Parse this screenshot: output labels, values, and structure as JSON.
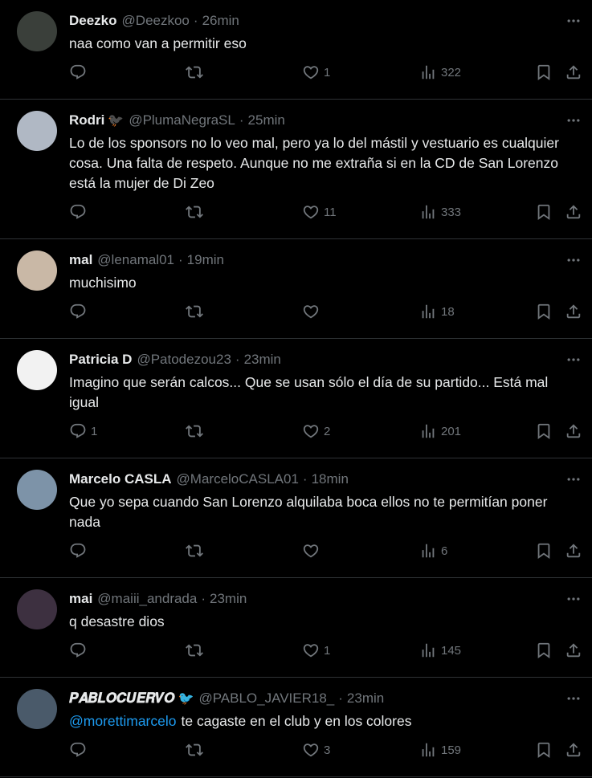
{
  "tweets": [
    {
      "name": "Deezko",
      "extra": "",
      "handle": "@Deezkoo",
      "time": "26min",
      "text": "naa como van a permitir eso",
      "mention": "",
      "replies": "",
      "retweets": "",
      "likes": "1",
      "views": "322",
      "avatar_color": "#3a3f3a"
    },
    {
      "name": "Rodri",
      "extra": "🐦‍⬛",
      "handle": "@PlumaNegraSL",
      "time": "25min",
      "text": "Lo de los sponsors no lo veo mal, pero ya lo del mástil y vestuario es cualquier cosa. Una falta de respeto. Aunque no me extraña si en la CD de San Lorenzo está la mujer de Di Zeo",
      "mention": "",
      "replies": "",
      "retweets": "",
      "likes": "11",
      "views": "333",
      "avatar_color": "#b0b8c4"
    },
    {
      "name": "mal",
      "extra": "",
      "handle": "@lenamal01",
      "time": "19min",
      "text": "muchisimo",
      "mention": "",
      "replies": "",
      "retweets": "",
      "likes": "",
      "views": "18",
      "avatar_color": "#c9b8a6"
    },
    {
      "name": "Patricia D",
      "extra": "",
      "handle": "@Patodezou23",
      "time": "23min",
      "text": "Imagino que serán calcos... Que se usan sólo el día de su partido... Está mal igual",
      "mention": "",
      "replies": "1",
      "retweets": "",
      "likes": "2",
      "views": "201",
      "avatar_color": "#f2f2f2"
    },
    {
      "name": "Marcelo CASLA",
      "extra": "",
      "handle": "@MarceloCASLA01",
      "time": "18min",
      "text": "Que yo sepa cuando San Lorenzo alquilaba boca ellos no te permitían poner nada",
      "mention": "",
      "replies": "",
      "retweets": "",
      "likes": "",
      "views": "6",
      "avatar_color": "#7d93a8"
    },
    {
      "name": "mai",
      "extra": "",
      "handle": "@maiii_andrada",
      "time": "23min",
      "text": "q desastre dios",
      "mention": "",
      "replies": "",
      "retweets": "",
      "likes": "1",
      "views": "145",
      "avatar_color": "#3d3040"
    },
    {
      "name": "𝑷𝑨𝑩𝑳𝑶𝑪𝑼𝑬𝑹𝑽𝑶",
      "extra": "🐦",
      "handle": "@PABLO_JAVIER18_",
      "time": "23min",
      "text": "te cagaste en el club y en los colores",
      "mention": "@morettimarcelo",
      "replies": "",
      "retweets": "",
      "likes": "3",
      "views": "159",
      "avatar_color": "#4a5a6a"
    }
  ],
  "icons": {
    "reply": "reply-icon",
    "retweet": "retweet-icon",
    "like": "heart-icon",
    "views": "views-icon",
    "bookmark": "bookmark-icon",
    "share": "share-icon",
    "more": "more-icon"
  },
  "colors": {
    "background": "#000000",
    "text": "#e7e9ea",
    "muted": "#71767b",
    "link": "#1d9bf0",
    "divider": "#2f3336"
  }
}
